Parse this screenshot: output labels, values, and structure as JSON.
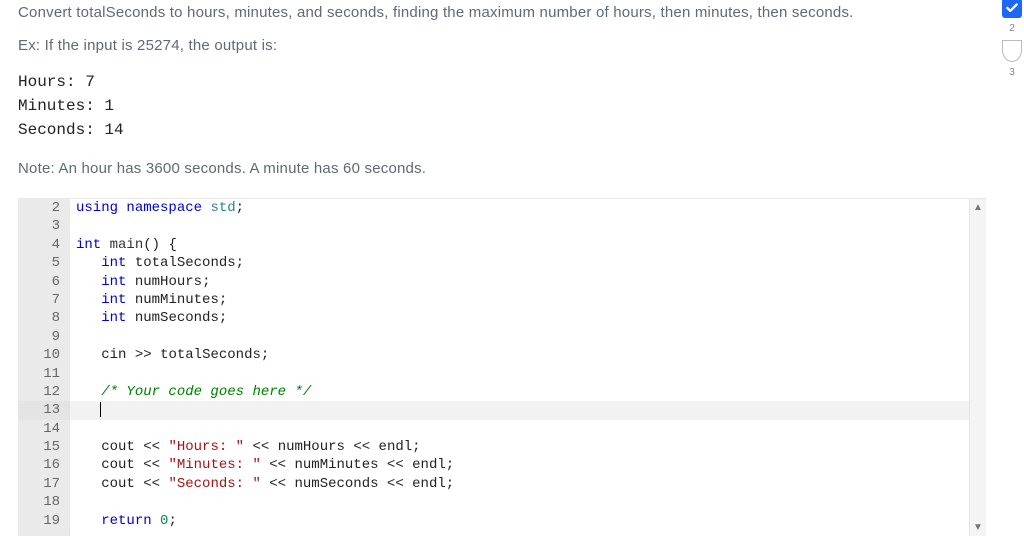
{
  "prompt": "Convert totalSeconds to hours, minutes, and seconds, finding the maximum number of hours, then minutes, then seconds.",
  "example_intro": "Ex: If the input is 25274, the output is:",
  "example_output": "Hours: 7\nMinutes: 1\nSeconds: 14",
  "note": "Note: An hour has 3600 seconds. A minute has 60 seconds.",
  "sidebar": {
    "badge_num_top": "2",
    "badge_num_bottom": "3"
  },
  "code": {
    "lines": [
      {
        "n": 2
      },
      {
        "n": 3
      },
      {
        "n": 4
      },
      {
        "n": 5
      },
      {
        "n": 6
      },
      {
        "n": 7
      },
      {
        "n": 8
      },
      {
        "n": 9
      },
      {
        "n": 10
      },
      {
        "n": 11
      },
      {
        "n": 12
      },
      {
        "n": 13
      },
      {
        "n": 14
      },
      {
        "n": 15
      },
      {
        "n": 16
      },
      {
        "n": 17
      },
      {
        "n": 18
      },
      {
        "n": 19
      }
    ],
    "tokens": {
      "using": "using",
      "namespace": "namespace",
      "std": "std",
      "int": "int",
      "main": "main",
      "totalSeconds": "totalSeconds",
      "numHours": "numHours",
      "numMinutes": "numMinutes",
      "numSeconds": "numSeconds",
      "cin": "cin",
      "comment_code_here": "/* Your code goes here */",
      "cout": "cout",
      "str_hours": "\"Hours: \"",
      "str_minutes": "\"Minutes: \"",
      "str_seconds": "\"Seconds: \"",
      "endl": "endl",
      "return": "return",
      "zero": "0"
    }
  }
}
